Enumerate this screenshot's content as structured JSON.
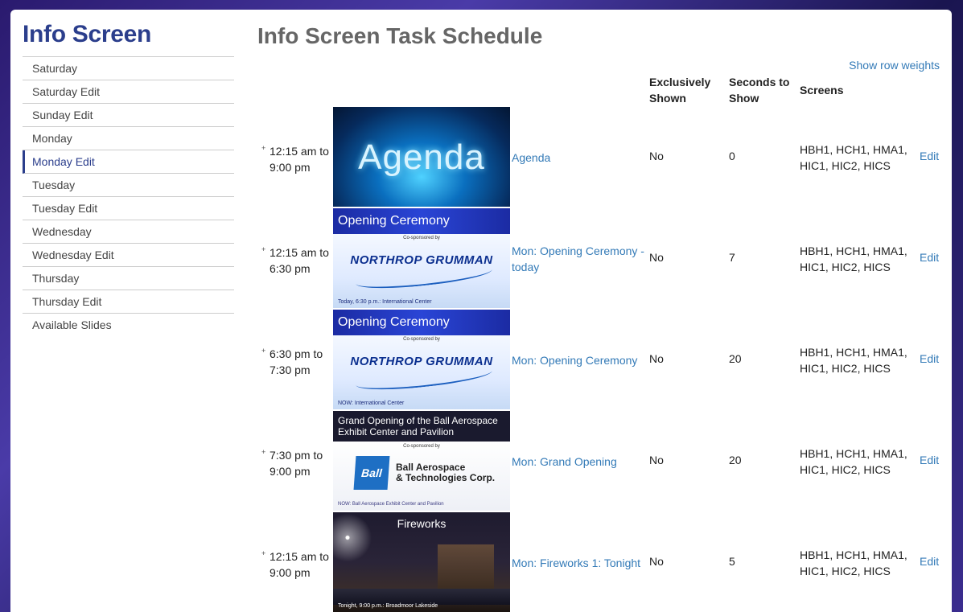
{
  "sidebar": {
    "brand": "Info Screen",
    "items": [
      {
        "label": "Saturday"
      },
      {
        "label": "Saturday Edit"
      },
      {
        "label": "Sunday Edit"
      },
      {
        "label": "Monday"
      },
      {
        "label": "Monday Edit"
      },
      {
        "label": "Tuesday"
      },
      {
        "label": "Tuesday Edit"
      },
      {
        "label": "Wednesday"
      },
      {
        "label": "Wednesday Edit"
      },
      {
        "label": "Thursday"
      },
      {
        "label": "Thursday Edit"
      },
      {
        "label": "Available Slides"
      }
    ]
  },
  "main": {
    "title": "Info Screen Task Schedule",
    "row_weights_link": "Show row weights",
    "headers": {
      "exclusively_shown_1": "Exclusively",
      "exclusively_shown_2": "Shown",
      "seconds_1": "Seconds to",
      "seconds_2": "Show",
      "screens": "Screens"
    },
    "rows": [
      {
        "mark": "+",
        "time_1": "12:15 am to",
        "time_2": "9:00 pm",
        "slide_text": {
          "big": "Agenda"
        },
        "title_1": "Agenda",
        "title_2": "",
        "exclusive": "No",
        "seconds": "0",
        "screens_1": "HBH1, HCH1, HMA1,",
        "screens_2": "HIC1, HIC2, HICS",
        "edit": "Edit"
      },
      {
        "mark": "+",
        "time_1": "12:15 am to",
        "time_2": "6:30 pm",
        "slide_text": {
          "band": "Opening Ceremony",
          "co": "Co-sponsored by",
          "logo": "NORTHROP GRUMMAN",
          "foot": "Today, 6:30 p.m.: International Center"
        },
        "title_1": "Mon: Opening Ceremony -",
        "title_2": "today",
        "exclusive": "No",
        "seconds": "7",
        "screens_1": "HBH1, HCH1, HMA1,",
        "screens_2": "HIC1, HIC2, HICS",
        "edit": "Edit"
      },
      {
        "mark": "+",
        "time_1": "6:30 pm to",
        "time_2": "7:30 pm",
        "slide_text": {
          "band": "Opening Ceremony",
          "co": "Co-sponsored by",
          "logo": "NORTHROP GRUMMAN",
          "foot": "NOW: International Center"
        },
        "title_1": "Mon: Opening Ceremony",
        "title_2": "",
        "exclusive": "No",
        "seconds": "20",
        "screens_1": "HBH1, HCH1, HMA1,",
        "screens_2": "HIC1, HIC2, HICS",
        "edit": "Edit"
      },
      {
        "mark": "+",
        "time_1": "7:30 pm to",
        "time_2": "9:00 pm",
        "slide_text": {
          "band_1": "Grand Opening of the Ball Aerospace",
          "band_2": "Exhibit Center and Pavilion",
          "co": "Co-sponsored by",
          "logo": "Ball",
          "name_1": "Ball Aerospace",
          "name_2": "& Technologies Corp.",
          "foot": "NOW: Ball Aerospace Exhibit Center and Pavilion"
        },
        "title_1": "Mon: Grand Opening",
        "title_2": "",
        "exclusive": "No",
        "seconds": "20",
        "screens_1": "HBH1, HCH1, HMA1,",
        "screens_2": "HIC1, HIC2, HICS",
        "edit": "Edit"
      },
      {
        "mark": "+",
        "time_1": "12:15 am to",
        "time_2": "9:00 pm",
        "slide_text": {
          "big": "Fireworks",
          "foot": "Tonight, 9:00 p.m.: Broadmoor Lakeside"
        },
        "title_1": "Mon: Fireworks 1: Tonight",
        "title_2": "",
        "exclusive": "No",
        "seconds": "5",
        "screens_1": "HBH1, HCH1, HMA1,",
        "screens_2": "HIC1, HIC2, HICS",
        "edit": "Edit"
      }
    ]
  }
}
